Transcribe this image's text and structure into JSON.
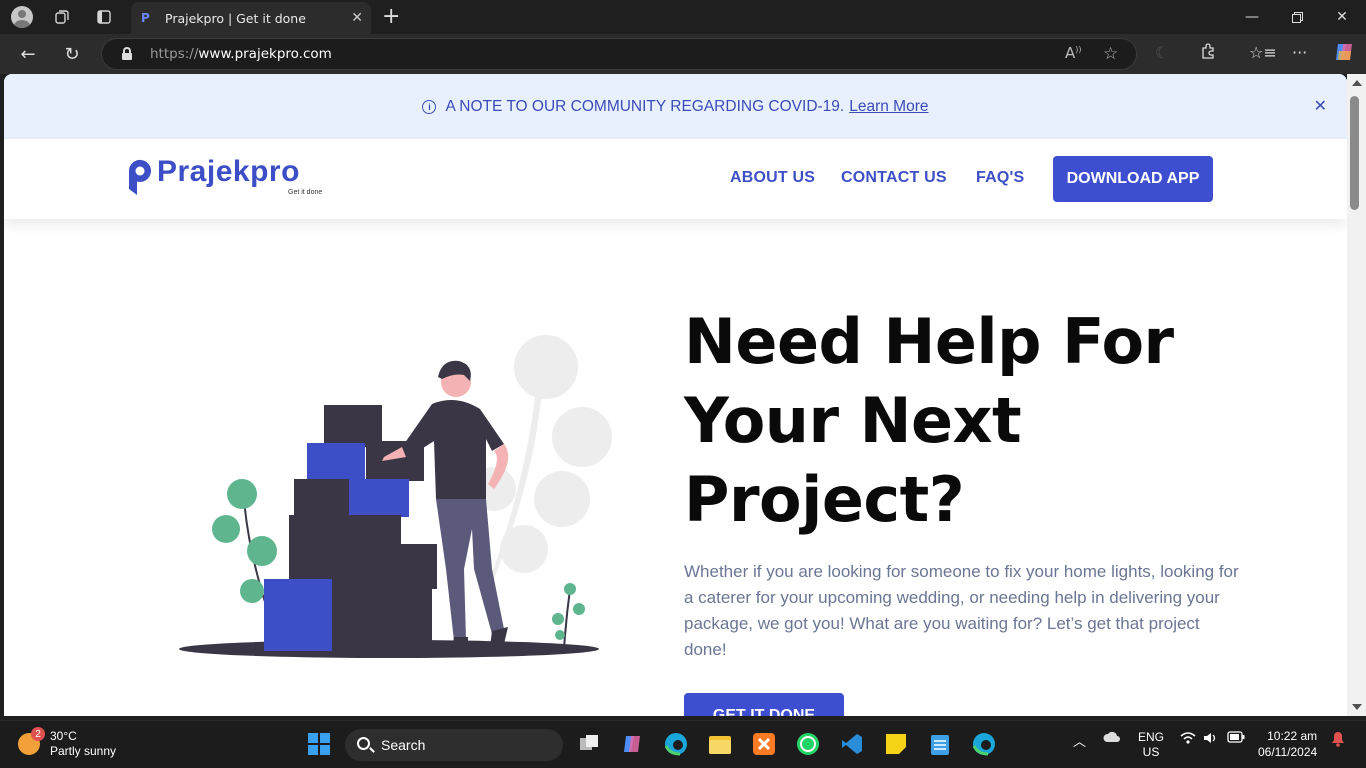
{
  "browser": {
    "tab_title": "Prajekpro | Get it done",
    "url_protocol": "https://",
    "url_host": "www.prajekpro.com"
  },
  "banner": {
    "text": "A NOTE TO OUR COMMUNITY REGARDING COVID-19.",
    "link": "Learn More"
  },
  "header": {
    "logo_text": "Prajekpro",
    "logo_tagline": "Get it done",
    "nav": [
      "ABOUT US",
      "CONTACT US",
      "FAQ'S"
    ],
    "download_label": "DOWNLOAD APP"
  },
  "hero": {
    "title_line1": "Need Help For",
    "title_line2": "Your Next",
    "title_line3": "Project?",
    "description": "Whether if you are looking for someone to fix your home lights, looking for a caterer for your upcoming wedding, or needing help in delivering your package, we got you! What are you waiting for? Let’s get that project done!",
    "cta_label": "GET IT DONE"
  },
  "taskbar": {
    "weather_temp": "30°C",
    "weather_desc": "Partly sunny",
    "weather_badge": "2",
    "search_label": "Search",
    "lang_line1": "ENG",
    "lang_line2": "US",
    "time": "10:22 am",
    "date": "06/11/2024"
  },
  "colors": {
    "brand": "#3d4fc7",
    "banner_bg": "#e8f0fe",
    "text_muted": "#6b7694"
  }
}
